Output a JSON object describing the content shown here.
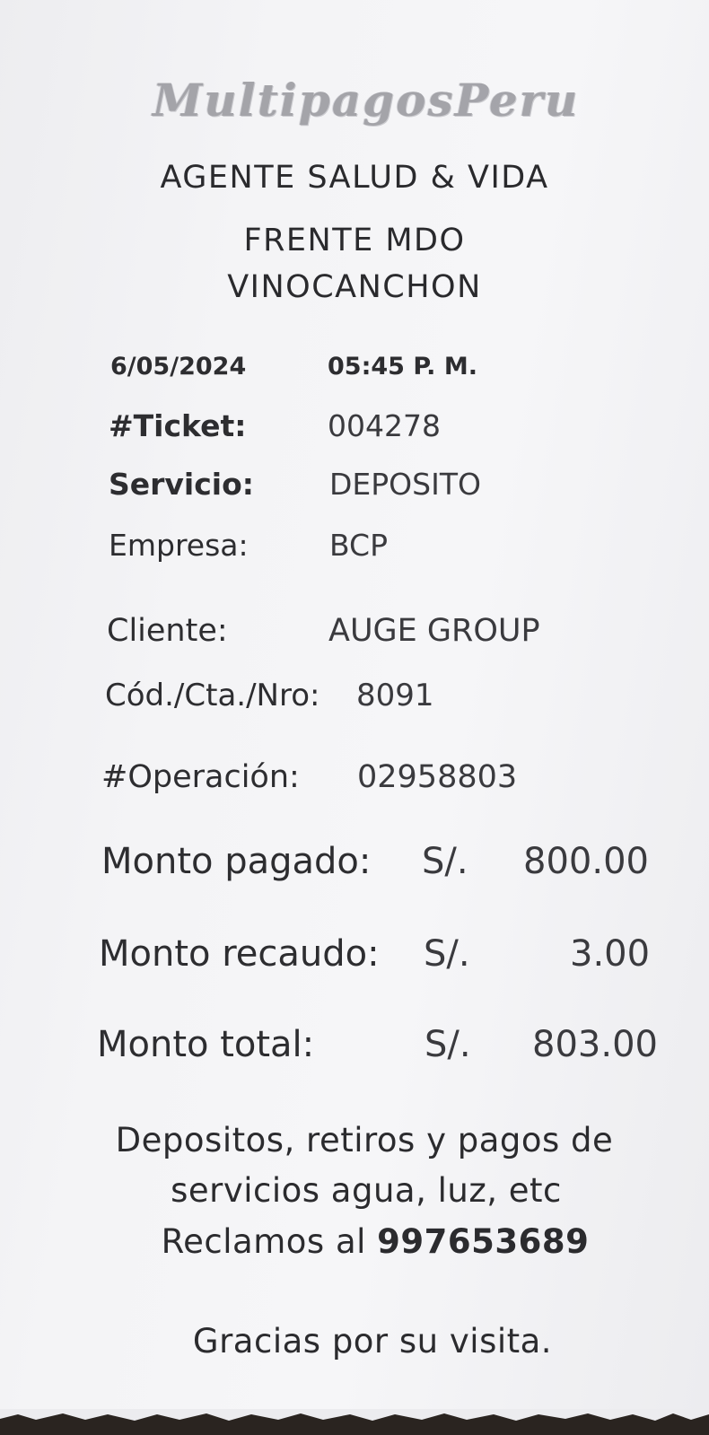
{
  "header": {
    "logo_text": "MultipagosPeru",
    "agent": "AGENTE SALUD & VIDA",
    "address_line1": "FRENTE MDO",
    "address_line2": "VINOCANCHON"
  },
  "ticket": {
    "date": "6/05/2024",
    "time": "05:45 P. M.",
    "ticket_label": "#Ticket:",
    "ticket_value": "004278",
    "service_label": "Servicio:",
    "service_value": "DEPOSITO",
    "company_label": "Empresa:",
    "company_value": "BCP",
    "client_label": "Cliente:",
    "client_value": "AUGE GROUP",
    "account_label": "Cód./Cta./Nro:",
    "account_value": "8091",
    "operation_label": "#Operación:",
    "operation_value": "02958803"
  },
  "amounts": {
    "currency": "S/.",
    "paid_label": "Monto pagado:",
    "paid_value": "800.00",
    "fee_label": "Monto recaudo:",
    "fee_value": "3.00",
    "total_label": "Monto total:",
    "total_value": "803.00"
  },
  "footer": {
    "line1": "Depositos, retiros y pagos de",
    "line2": "servicios agua, luz, etc",
    "claims_prefix": "Reclamos al ",
    "claims_phone": "997653689",
    "thanks": "Gracias por su visita."
  }
}
